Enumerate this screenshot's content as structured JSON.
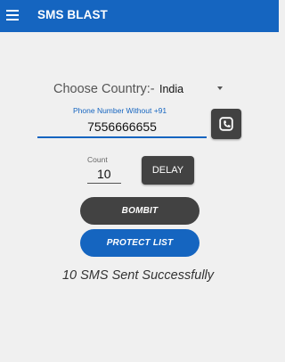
{
  "app": {
    "title": "SMS BLAST",
    "theme_color": "#1565c0",
    "dark_color": "#424242"
  },
  "country": {
    "label": "Choose Country:-",
    "selected": "India"
  },
  "phone": {
    "hint": "Phone Number Without +91",
    "value": "7556666655"
  },
  "count": {
    "hint": "Count",
    "value": "10"
  },
  "buttons": {
    "delay": "DELAY",
    "bombit": "BOMBIT",
    "protect": "PROTECT LIST"
  },
  "status": {
    "message": "10 SMS Sent Successfully"
  },
  "icons": {
    "menu": "hamburger-menu-icon",
    "contact": "contact-phone-icon",
    "dropdown": "dropdown-arrow-icon"
  }
}
